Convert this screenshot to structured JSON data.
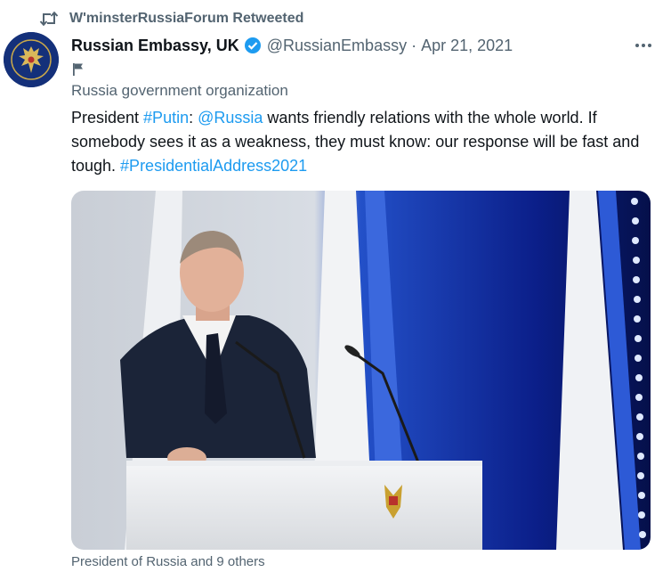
{
  "social_context": {
    "text": "W'minsterRussiaForum Retweeted",
    "icon": "retweet-icon"
  },
  "author": {
    "name": "Russian Embassy, UK",
    "handle": "@RussianEmbassy",
    "separator": "·",
    "date": "Apr 21, 2021",
    "label": "Russia government organization",
    "verified_color": "#1d9bf0"
  },
  "tweet": {
    "parts": [
      {
        "text": "President ",
        "link": false
      },
      {
        "text": "#Putin",
        "link": true
      },
      {
        "text": ": ",
        "link": false
      },
      {
        "text": "@Russia",
        "link": true
      },
      {
        "text": " wants friendly relations with the whole world. If somebody sees it as a weakness, they must know: our response will be fast and tough. ",
        "link": false
      },
      {
        "text": "#PresidentialAddress2021",
        "link": true
      }
    ]
  },
  "media": {
    "caption": "President of Russia and 9 others"
  },
  "colors": {
    "link": "#1d9bf0",
    "secondary": "#536471",
    "text": "#0f1419"
  }
}
